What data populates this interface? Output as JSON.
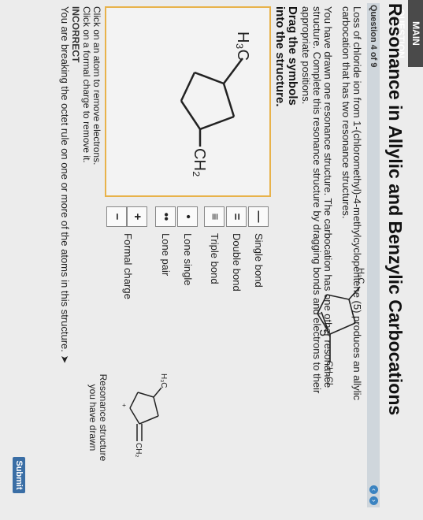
{
  "header": {
    "tab_label": "MAIN QUESTION",
    "title": "Resonance in Allylic and Benzylic Carbocations",
    "question_number": "Question 4 of 9"
  },
  "prompt": {
    "intro_line1": "Loss of chloride ion from 1-(chloromethyl)-4-methylcyclopentene (5) produces an allylic",
    "intro_line2": "carbocation that has two resonance structures.",
    "instr_line1": "You have drawn one resonance structure. The carbocation has one other resonance",
    "instr_line2": "structure. Complete this resonance structure by dragging bonds and electrons to their",
    "instr_line3": "appropriate positions.",
    "drag_line1": "Drag the symbols",
    "drag_line2": "into the structure."
  },
  "canvas_molecule": {
    "substituent_top": "H₃C",
    "substituent_bottom": "CH₂"
  },
  "tools": [
    {
      "symbol": "—",
      "label": "Single bond"
    },
    {
      "symbol": "=",
      "label": "Double bond"
    },
    {
      "symbol": "≡",
      "label": "Triple bond"
    },
    {
      "symbol": "•",
      "label": "Lone single"
    },
    {
      "symbol": "••",
      "label": "Lone pair"
    },
    {
      "symbol": "+",
      "label": "Formal charge"
    },
    {
      "symbol": "−",
      "label": ""
    }
  ],
  "reference": {
    "compound_number": "5",
    "compound_top_group": "H₃C",
    "compound_side_group": "CH₂Cl",
    "cation_top_group": "H₃C",
    "cation_side_group": "CH₂",
    "caption_line1": "Resonance structure",
    "caption_line2": "you have drawn"
  },
  "feedback": {
    "hint1": "Click on an atom to remove electrons.",
    "hint2": "Click on a formal charge to remove it.",
    "status": "INCORRECT",
    "message": "You are breaking the octet rule on one or more of the atoms in this structure."
  },
  "actions": {
    "submit_label": "Submit"
  }
}
